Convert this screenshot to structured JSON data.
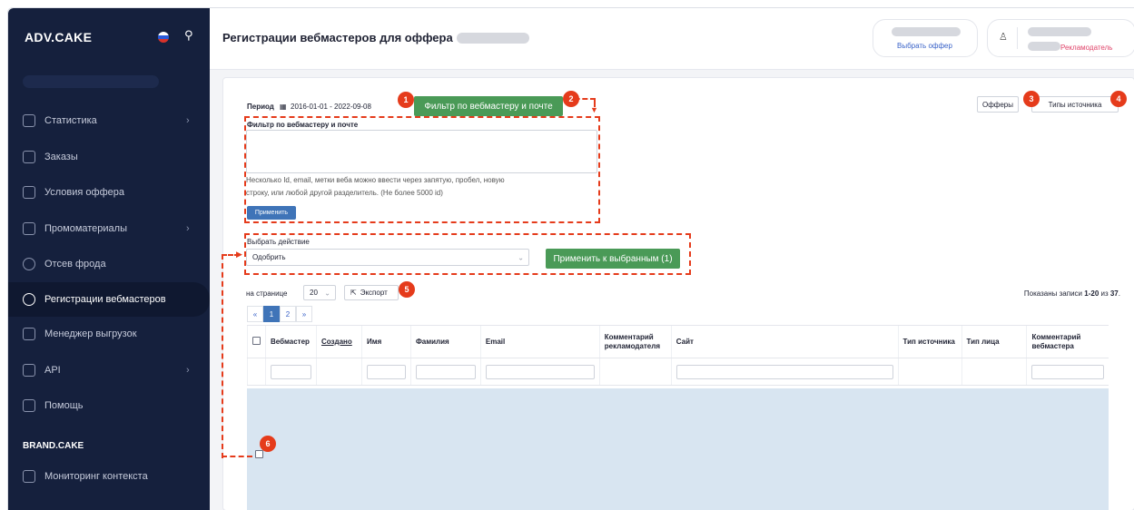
{
  "sidebar": {
    "logo": "ADV.CAKE",
    "items": [
      {
        "label": "Статистика"
      },
      {
        "label": "Заказы"
      },
      {
        "label": "Условия оффера"
      },
      {
        "label": "Промоматериалы"
      },
      {
        "label": "Отсев фрода"
      },
      {
        "label": "Регистрации вебмастеров"
      },
      {
        "label": "Менеджер выгрузок"
      },
      {
        "label": "API"
      },
      {
        "label": "Помощь"
      }
    ],
    "section_title": "BRAND.CAKE",
    "section_items": [
      {
        "label": "Мониторинг контекста"
      }
    ]
  },
  "header": {
    "title": "Регистрации вебмастеров для оффера",
    "choose_offer_link": "Выбрать оффер",
    "role": "Рекламодатель"
  },
  "filters": {
    "period_label": "Период",
    "period_value": "2016-01-01 - 2022-09-08",
    "filter_button": "Фильтр по вебмастеру и почте",
    "offers_button": "Офферы",
    "source_types_button": "Типы источника",
    "filter_panel_title": "Фильтр по вебмастеру и почте",
    "hint_line1": "Несколько Id, email, метки веба можно ввести через запятую, пробел, новую",
    "hint_line2": "строку, или любой другой разделитель. (Не более 5000 id)",
    "apply_button": "Применить"
  },
  "action": {
    "label": "Выбрать действие",
    "selected": "Одобрить",
    "apply_selected_button": "Применить к выбранным (1)"
  },
  "list_controls": {
    "per_page_label": "на странице",
    "per_page_value": "20",
    "export_label": "Экспорт",
    "records_prefix": "Показаны записи ",
    "records_range": "1-20",
    "records_of": " из ",
    "records_total": "37",
    "records_suffix": ".",
    "pages": [
      "«",
      "1",
      "2",
      "»"
    ]
  },
  "table": {
    "columns": [
      "Вебмастер",
      "Создано",
      "Имя",
      "Фамилия",
      "Email",
      "Комментарий рекламодателя",
      "Сайт",
      "Тип источника",
      "Тип лица",
      "Комментарий вебмастера"
    ]
  },
  "annotations": [
    "1",
    "2",
    "3",
    "4",
    "5",
    "6"
  ],
  "colors": {
    "sidebar_bg": "#15203d",
    "accent_green": "#4a9a57",
    "annotation_red": "#e53b1b",
    "pager_active": "#3f74b8",
    "role_pink": "#e0446a"
  }
}
